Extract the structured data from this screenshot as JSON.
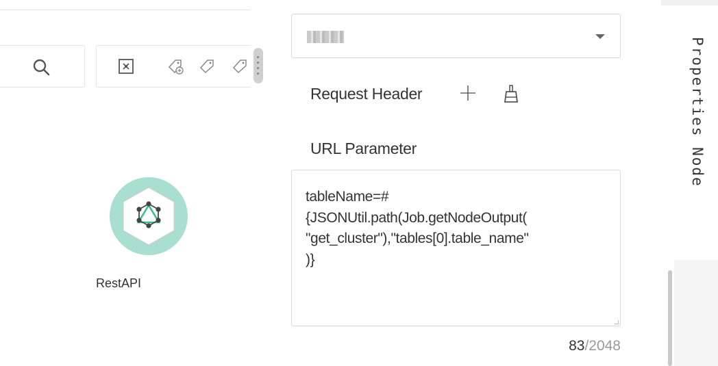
{
  "canvas": {
    "node_label": "RestAPI"
  },
  "panel": {
    "selected_value": "",
    "request_header_label": "Request Header",
    "url_parameter_label": "URL Parameter",
    "url_parameter_value": "tableName=#\n{JSONUtil.path(Job.getNodeOutput(\n\"get_cluster\"),\"tables[0].table_name\"\n)}",
    "char_count": "83",
    "char_max": "/2048"
  },
  "side_tab": {
    "label": "Properties Node"
  },
  "colors": {
    "node_ring": "#a8dfcf",
    "node_accent": "#3dbd93",
    "border": "#d9d9d9"
  },
  "icons": [
    "search-icon",
    "fit-view-icon",
    "tag-add-icon",
    "tag-icon",
    "tag-more-icon",
    "plus-icon",
    "clean-icon",
    "dropdown-caret-icon"
  ]
}
